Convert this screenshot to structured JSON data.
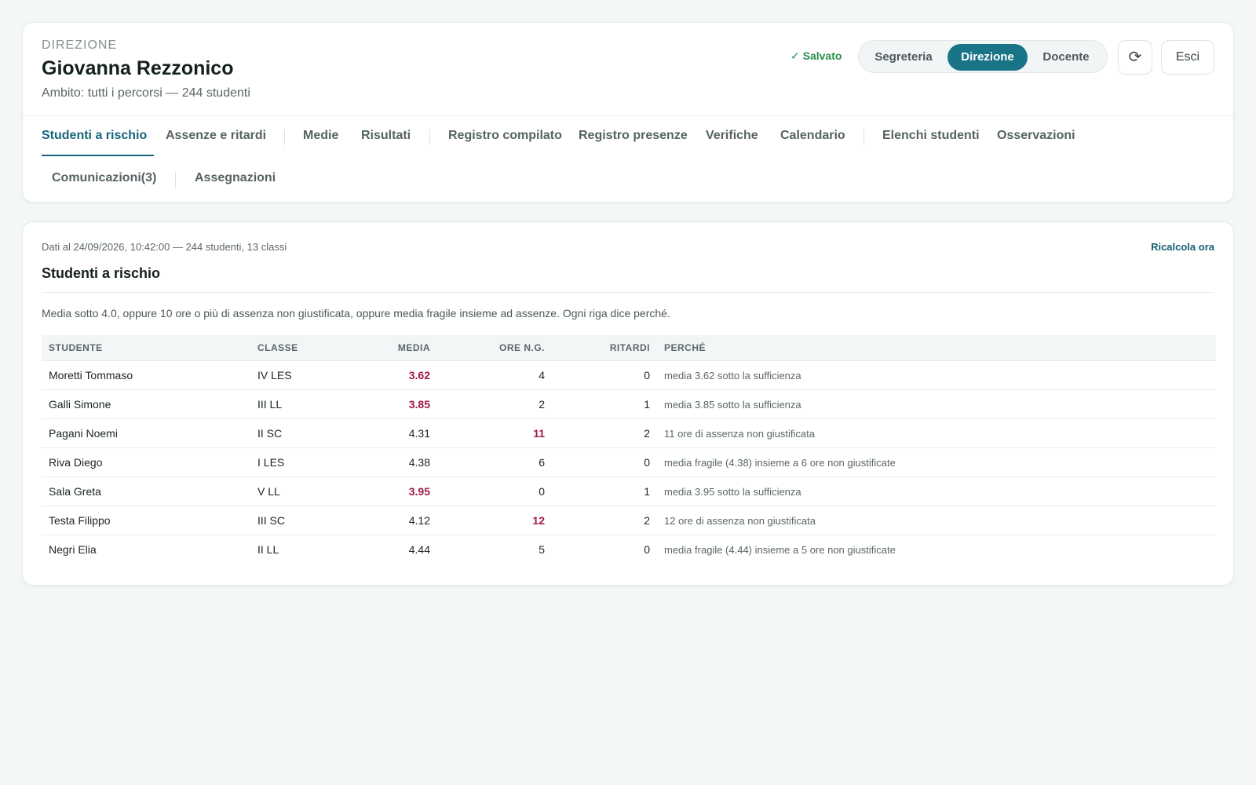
{
  "header": {
    "role": "DIREZIONE",
    "user_name": "Giovanna Rezzonico",
    "scope": "Ambito: tutti i percorsi — 244 studenti",
    "saved": "✓ Salvato",
    "roles": [
      "Segreteria",
      "Direzione",
      "Docente"
    ],
    "active_role": "Direzione",
    "refresh_icon": "⟳",
    "exit_label": "Esci"
  },
  "tabs": [
    "Studenti a rischio",
    "Assenze e ritardi",
    "Medie",
    "Risultati",
    "Registro compilato",
    "Registro presenze",
    "Verifiche",
    "Calendario",
    "Elenchi studenti",
    "Osservazioni",
    "Comunicazioni(3)",
    "Assegnazioni"
  ],
  "active_tab": "Studenti a rischio",
  "main": {
    "data_stamp": "Dati al 24/09/2026, 10:42:00 — 244 studenti, 13 classi",
    "recalc_label": "Ricalcola ora",
    "title": "Studenti a rischio",
    "description": "Media sotto 4.0, oppure 10 ore o più di assenza non giustificata, oppure media fragile insieme ad assenze. Ogni riga dice perché.",
    "columns": [
      "STUDENTE",
      "CLASSE",
      "MEDIA",
      "ORE N.G.",
      "RITARDI",
      "PERCHÉ"
    ],
    "rows": [
      {
        "student": "Moretti Tommaso",
        "class": "IV LES",
        "media": "3.62",
        "media_alert": true,
        "ore": "4",
        "ore_alert": false,
        "ritardi": "0",
        "reason": "media 3.62 sotto la sufficienza"
      },
      {
        "student": "Galli Simone",
        "class": "III LL",
        "media": "3.85",
        "media_alert": true,
        "ore": "2",
        "ore_alert": false,
        "ritardi": "1",
        "reason": "media 3.85 sotto la sufficienza"
      },
      {
        "student": "Pagani Noemi",
        "class": "II SC",
        "media": "4.31",
        "media_alert": false,
        "ore": "11",
        "ore_alert": true,
        "ritardi": "2",
        "reason": "11 ore di assenza non giustificata"
      },
      {
        "student": "Riva Diego",
        "class": "I LES",
        "media": "4.38",
        "media_alert": false,
        "ore": "6",
        "ore_alert": false,
        "ritardi": "0",
        "reason": "media fragile (4.38) insieme a 6 ore non giustificate"
      },
      {
        "student": "Sala Greta",
        "class": "V LL",
        "media": "3.95",
        "media_alert": true,
        "ore": "0",
        "ore_alert": false,
        "ritardi": "1",
        "reason": "media 3.95 sotto la sufficienza"
      },
      {
        "student": "Testa Filippo",
        "class": "III SC",
        "media": "4.12",
        "media_alert": false,
        "ore": "12",
        "ore_alert": true,
        "ritardi": "2",
        "reason": "12 ore di assenza non giustificata"
      },
      {
        "student": "Negri Elia",
        "class": "II LL",
        "media": "4.44",
        "media_alert": false,
        "ore": "5",
        "ore_alert": false,
        "ritardi": "0",
        "reason": "media fragile (4.44) insieme a 5 ore non giustificate"
      }
    ]
  },
  "colors": {
    "accent": "#1a7487",
    "alert": "#a01a48",
    "saved": "#2a8d4d"
  }
}
